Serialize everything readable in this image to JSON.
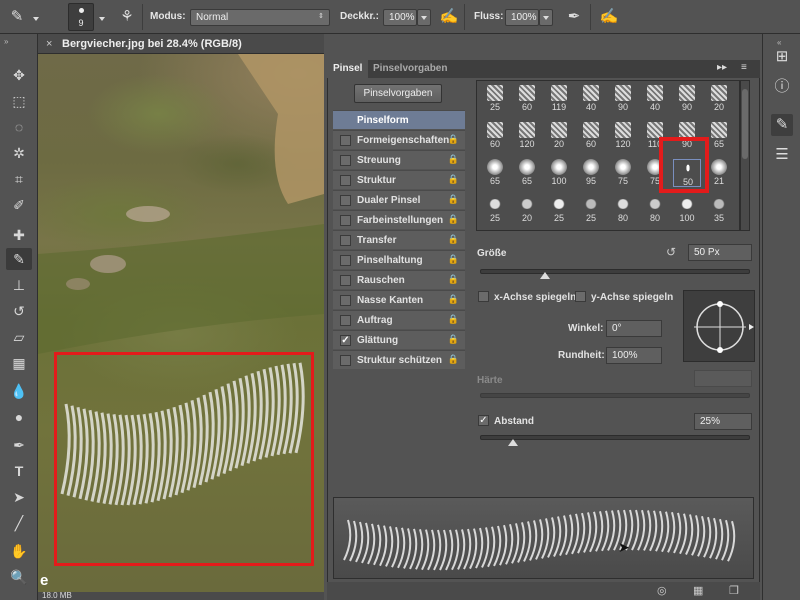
{
  "options_bar": {
    "brush_size": "9",
    "modus_label": "Modus:",
    "modus_value": "Normal",
    "opacity_label": "Deckkr.:",
    "opacity_value": "100%",
    "flow_label": "Fluss:",
    "flow_value": "100%"
  },
  "document": {
    "tab_title": "Bergviecher.jpg bei 28.4% (RGB/8)",
    "status_size": "18.0 MB",
    "corner_text": "e"
  },
  "brush_panel": {
    "tabs": [
      "Pinsel",
      "Pinselvorgaben"
    ],
    "presets_button": "Pinselvorgaben",
    "list": [
      {
        "label": "Pinselform",
        "checkbox": false,
        "checked": false,
        "lock": false,
        "selected": true
      },
      {
        "label": "Formeigenschaften",
        "checkbox": true,
        "checked": false,
        "lock": true
      },
      {
        "label": "Streuung",
        "checkbox": true,
        "checked": false,
        "lock": true
      },
      {
        "label": "Struktur",
        "checkbox": true,
        "checked": false,
        "lock": true
      },
      {
        "label": "Dualer Pinsel",
        "checkbox": true,
        "checked": false,
        "lock": true
      },
      {
        "label": "Farbeinstellungen",
        "checkbox": true,
        "checked": false,
        "lock": true
      },
      {
        "label": "Transfer",
        "checkbox": true,
        "checked": false,
        "lock": true
      },
      {
        "label": "Pinselhaltung",
        "checkbox": true,
        "checked": false,
        "lock": true
      },
      {
        "label": "Rauschen",
        "checkbox": true,
        "checked": false,
        "lock": true
      },
      {
        "label": "Nasse Kanten",
        "checkbox": true,
        "checked": false,
        "lock": true
      },
      {
        "label": "Auftrag",
        "checkbox": true,
        "checked": false,
        "lock": true
      },
      {
        "label": "Glättung",
        "checkbox": true,
        "checked": true,
        "lock": true
      },
      {
        "label": "Struktur schützen",
        "checkbox": true,
        "checked": false,
        "lock": true
      }
    ],
    "tips": [
      "25",
      "60",
      "119",
      "40",
      "90",
      "40",
      "90",
      "20",
      "60",
      "120",
      "20",
      "60",
      "120",
      "110",
      "90",
      "65",
      "65",
      "65",
      "100",
      "95",
      "75",
      "75",
      "50",
      "21",
      "25",
      "20",
      "25",
      "25",
      "80",
      "80",
      "100",
      "35"
    ],
    "selected_tip": "50",
    "size_label": "Größe",
    "size_value": "50 Px",
    "flip_x_label": "x-Achse spiegeln",
    "flip_y_label": "y-Achse spiegeln",
    "angle_label": "Winkel:",
    "angle_value": "0°",
    "roundness_label": "Rundheit:",
    "roundness_value": "100%",
    "hardness_label": "Härte",
    "spacing_label": "Abstand",
    "spacing_value": "25%",
    "spacing_checked": true
  },
  "colors": {
    "highlight_red": "#e31b1b",
    "selected_row": "#6e7c95"
  }
}
